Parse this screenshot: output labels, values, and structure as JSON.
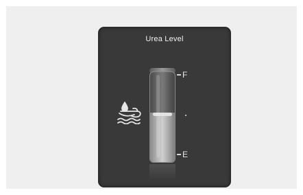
{
  "gauge": {
    "title": "Urea Level",
    "full_label": "F",
    "empty_label": "E",
    "level_fraction": 0.55,
    "icon": "urea-fluid-icon"
  },
  "colors": {
    "panel_background": "#393939",
    "page_background": "#efefef",
    "text": "#f2f2f2"
  }
}
